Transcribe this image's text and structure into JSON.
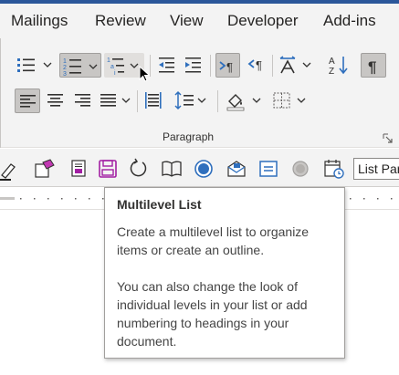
{
  "tabs": [
    "Mailings",
    "Review",
    "View",
    "Developer",
    "Add-ins"
  ],
  "ribbon": {
    "group_label": "Paragraph",
    "row1": [
      "bullets-icon",
      "numbering-icon",
      "multilevel-list-icon",
      "decrease-indent-icon",
      "increase-indent-icon",
      "ltr-text-direction-icon",
      "rtl-text-direction-icon",
      "asian-layout-icon",
      "sort-icon",
      "show-formatting-marks-icon"
    ],
    "row2": [
      "align-left-icon",
      "align-center-icon",
      "align-right-icon",
      "justify-icon",
      "distributed-icon",
      "line-spacing-icon",
      "shading-icon",
      "borders-icon"
    ]
  },
  "qat": {
    "style_box_value": "List Par",
    "buttons": [
      "highlight-pen-icon",
      "clear-format-icon",
      "print-preview-icon",
      "save-icon",
      "redo-icon",
      "read-mode-icon",
      "record-icon",
      "mail-icon",
      "form-icon",
      "circle-icon",
      "date-icon"
    ]
  },
  "tooltip": {
    "title": "Multilevel List",
    "paragraph1": "Create a multilevel list to organize items or create an outline.",
    "paragraph2": "You can also change the look of individual levels in your list or add numbering to headings in your document."
  },
  "colors": {
    "ribbon_bg": "#f3f3f3",
    "accent_blue": "#2b579a",
    "icon_blue": "#2f6fbd",
    "save_purple": "#a21fa3"
  }
}
